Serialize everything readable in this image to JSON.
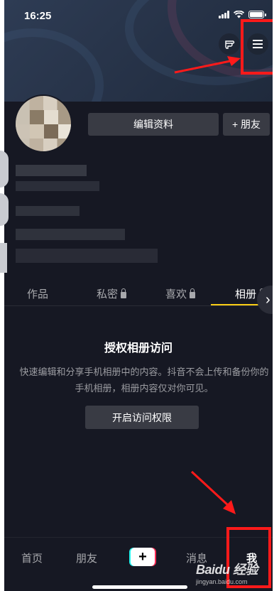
{
  "status_bar": {
    "time": "16:25"
  },
  "header": {
    "gesture_icon": "hand-pointer-icon",
    "menu_icon": "hamburger-menu-icon"
  },
  "profile": {
    "edit_button": "编辑资料",
    "friends_button": "+ 朋友"
  },
  "tabs": [
    {
      "label": "作品",
      "locked": false
    },
    {
      "label": "私密",
      "locked": true
    },
    {
      "label": "喜欢",
      "locked": true
    },
    {
      "label": "相册",
      "locked": true,
      "active": true
    }
  ],
  "album": {
    "title": "授权相册访问",
    "description": "快速编辑和分享手机相册中的内容。抖音不会上传和备份你的手机相册，相册内容仅对你可见。",
    "button": "开启访问权限"
  },
  "bottom_nav": {
    "items": [
      "首页",
      "朋友",
      "消息",
      "我"
    ],
    "active": "我",
    "plus": "+"
  },
  "watermark": {
    "brand": "Baidu 经验",
    "site": "jingyan.baidu.com"
  },
  "colors": {
    "background": "#161823",
    "accent": "#face15",
    "annotation": "#ff1a1a"
  }
}
